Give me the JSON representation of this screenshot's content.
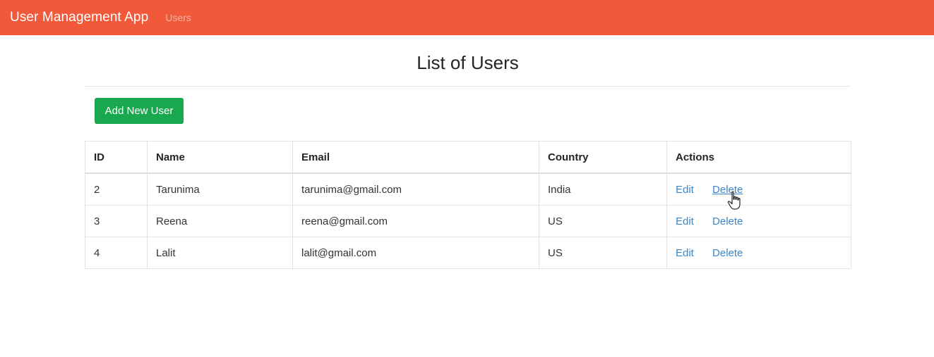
{
  "navbar": {
    "brand": "User Management App",
    "link": "Users"
  },
  "page": {
    "title": "List of Users"
  },
  "toolbar": {
    "add_label": "Add New User"
  },
  "table": {
    "headers": {
      "id": "ID",
      "name": "Name",
      "email": "Email",
      "country": "Country",
      "actions": "Actions"
    },
    "rows": [
      {
        "id": "2",
        "name": "Tarunima",
        "email": "tarunima@gmail.com",
        "country": "India",
        "edit": "Edit",
        "delete": "Delete"
      },
      {
        "id": "3",
        "name": "Reena",
        "email": "reena@gmail.com",
        "country": "US",
        "edit": "Edit",
        "delete": "Delete"
      },
      {
        "id": "4",
        "name": "Lalit",
        "email": "lalit@gmail.com",
        "country": "US",
        "edit": "Edit",
        "delete": "Delete"
      }
    ]
  },
  "colors": {
    "navbar": "#f05a3a",
    "add_button": "#1aa84e",
    "link": "#3a86c8"
  },
  "icons": {
    "cursor": "hand-pointer-icon"
  }
}
